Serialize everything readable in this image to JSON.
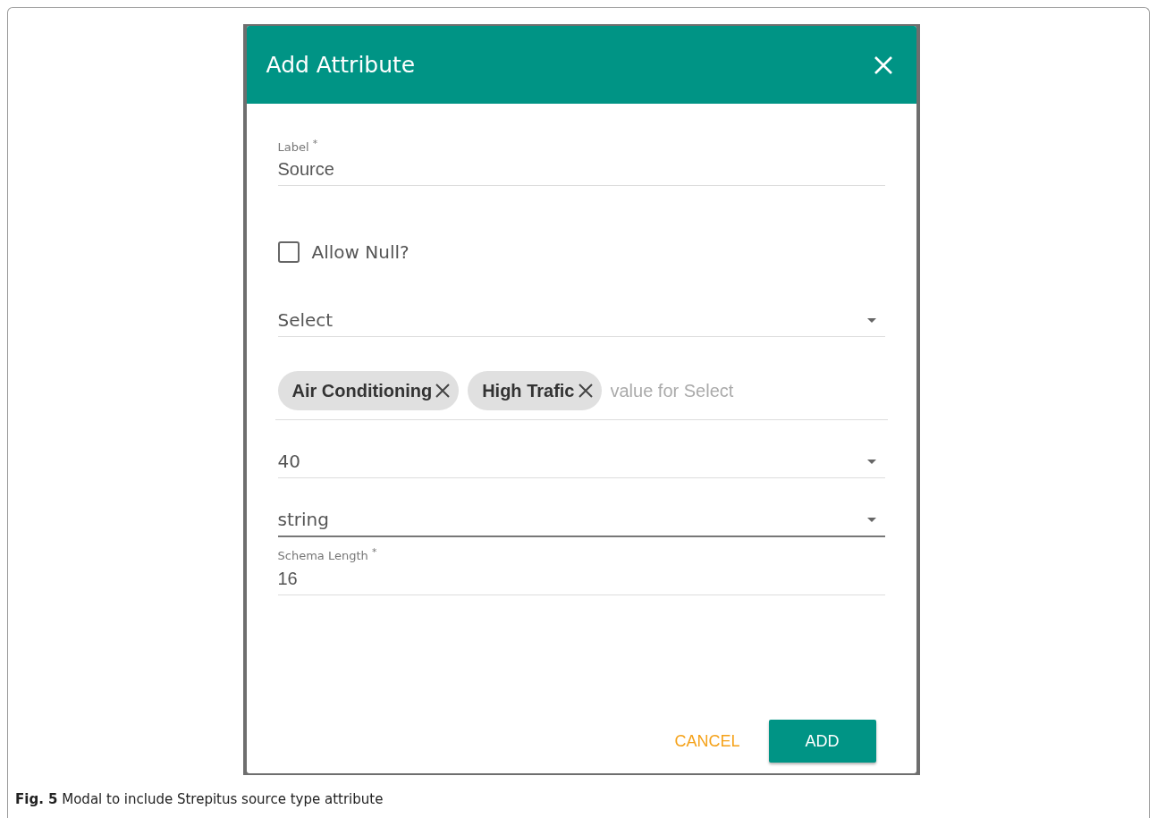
{
  "dialog": {
    "title": "Add Attribute",
    "fields": [
      {
        "kind": "text",
        "label": "Label $^{*}$",
        "value": "Source"
      },
      {
        "kind": "checkbox",
        "label": "Allow Null?",
        "checked": false
      },
      {
        "kind": "select",
        "value": "Select",
        "focused": false
      },
      {
        "kind": "chips",
        "chips": [
          "Air Conditioning",
          "High Trafic"
        ],
        "placeholder": "value for Select"
      },
      {
        "kind": "select",
        "value": "40",
        "focused": false
      },
      {
        "kind": "select",
        "value": "string",
        "focused": true
      },
      {
        "kind": "text",
        "label": "Schema Length $^{*}$",
        "value": "16"
      }
    ],
    "buttons": [
      {
        "label": "CANCEL",
        "kind": "text"
      },
      {
        "label": "ADD",
        "kind": "primary"
      }
    ]
  },
  "caption": "**Fig. 5** Modal to include Strepitus source type attribute"
}
